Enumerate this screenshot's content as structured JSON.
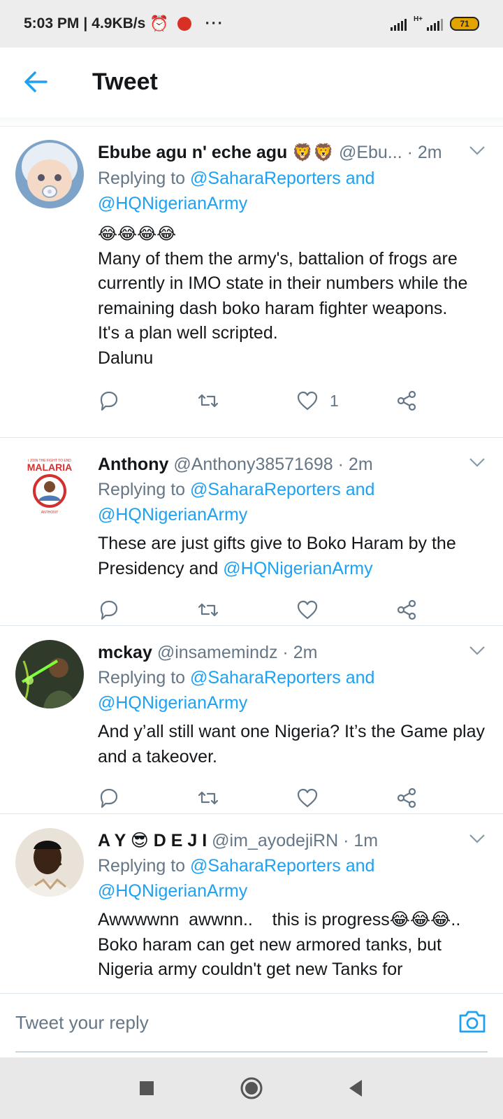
{
  "status_bar": {
    "time": "5:03 PM",
    "speed": "4.9KB/s",
    "network_type": "H+",
    "battery": "71"
  },
  "header": {
    "title": "Tweet"
  },
  "tweets": [
    {
      "name": "Ebube agu n' eche agu",
      "name_emoji": "🦁🦁",
      "handle": "@Ebu...",
      "time": "· 2m",
      "replying_prefix": "Replying to",
      "mention1": "@SaharaReporters",
      "and_word": "and",
      "mention2": "@HQNigerianArmy",
      "emoji_line": "😂😂😂😂",
      "text": "Many of them the army's, battalion of frogs are currently in IMO state in their numbers while the remaining dash boko haram fighter weapons.\nIt's a plan well scripted.\nDalunu",
      "likes": "1"
    },
    {
      "name": "Anthony",
      "handle": "@Anthony38571698",
      "time": "· 2m",
      "replying_prefix": "Replying to",
      "mention1": "@SaharaReporters",
      "and_word": "and",
      "mention2": "@HQNigerianArmy",
      "text": "These are just gifts give to Boko Haram by the Presidency and ",
      "text_mention": "@HQNigerianArmy",
      "avatar_text_top": "I JOIN THE FIGHT TO END",
      "avatar_text_main": "MALARIA",
      "avatar_text_bottom": "ANTHONY"
    },
    {
      "name": "mckay",
      "handle": "@insamemindz",
      "time": "· 2m",
      "replying_prefix": "Replying to",
      "mention1": "@SaharaReporters",
      "and_word": "and",
      "mention2": "@HQNigerianArmy",
      "text": "And y’all still want one Nigeria? It’s the Game play and a takeover."
    },
    {
      "name": "A Y 😎 D E J I",
      "handle": "@im_ayodejiRN",
      "time": "· 1m",
      "replying_prefix": "Replying to",
      "mention1": "@SaharaReporters",
      "and_word": "and",
      "mention2": "@HQNigerianArmy",
      "text": "Awwwwnn  awwnn..    this is progress😂😂😂..  Boko haram can get new armored tanks, but Nigeria army couldn't get new Tanks for"
    }
  ],
  "reply_bar": {
    "placeholder": "Tweet your reply"
  },
  "colors": {
    "accent": "#1da1f2",
    "secondary_text": "#657786",
    "primary_text": "#14171a"
  }
}
